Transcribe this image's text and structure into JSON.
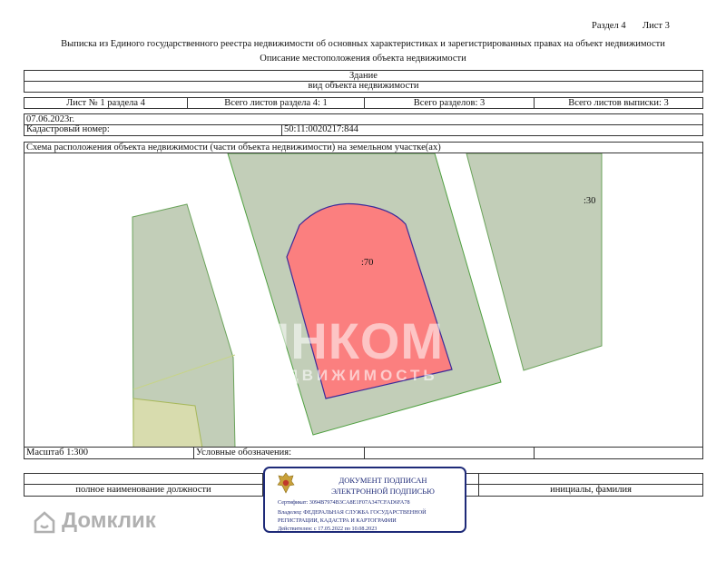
{
  "header": {
    "section": "Раздел 4",
    "sheet": "Лист 3",
    "title": "Выписка из Единого государственного реестра недвижимости об основных характеристиках и зарегистрированных правах на объект недвижимости",
    "subtitle": "Описание местоположения объекта недвижимости"
  },
  "object_type": {
    "value": "Здание",
    "label": "вид объекта недвижимости"
  },
  "sheets_row": {
    "sheet_no": "Лист № 1 раздела 4",
    "total_sheets_section": "Всего листов раздела 4: 1",
    "total_sections": "Всего разделов: 3",
    "total_sheets_extract": "Всего листов выписки: 3"
  },
  "date": "07.06.2023г.",
  "cadastral": {
    "label": "Кадастровый номер:",
    "value": "50:11:0020217:844"
  },
  "scheme_title": "Схема расположения объекта недвижимости (части объекта недвижимости) на земельном участке(ах)",
  "map": {
    "building_label": ":70",
    "parcel_label": ":30",
    "watermark_main": "ИНКОМ",
    "watermark_sub": "НЕДВИЖИМОСТЬ",
    "colors": {
      "building_fill": "#fb7f7f",
      "building_stroke": "#3b2a9a",
      "parcel_fill": "#c2ceb8",
      "parcel_stroke": "#6aa35a"
    }
  },
  "footer_row": {
    "scale": "Масштаб 1:300",
    "legend": "Условные обозначения:"
  },
  "signature": {
    "position_label": "полное наименование должности",
    "initials_label": "инициалы, фамилия",
    "stamp_line1": "ДОКУМЕНТ ПОДПИСАН",
    "stamp_line2": "ЭЛЕКТРОННОЙ ПОДПИСЬЮ",
    "cert": "Сертификат: 3094B7974B3CA8E1F07A347CFAD6FA78",
    "owner1": "Владелец: ФЕДЕРАЛЬНАЯ СЛУЖБА ГОСУДАРСТВЕННОЙ",
    "owner2": "РЕГИСТРАЦИИ, КАДАСТРА И КАРТОГРАФИИ",
    "valid": "Действителен: с 17.05.2022 по 10.08.2023"
  },
  "brand_watermark": "Домклик"
}
